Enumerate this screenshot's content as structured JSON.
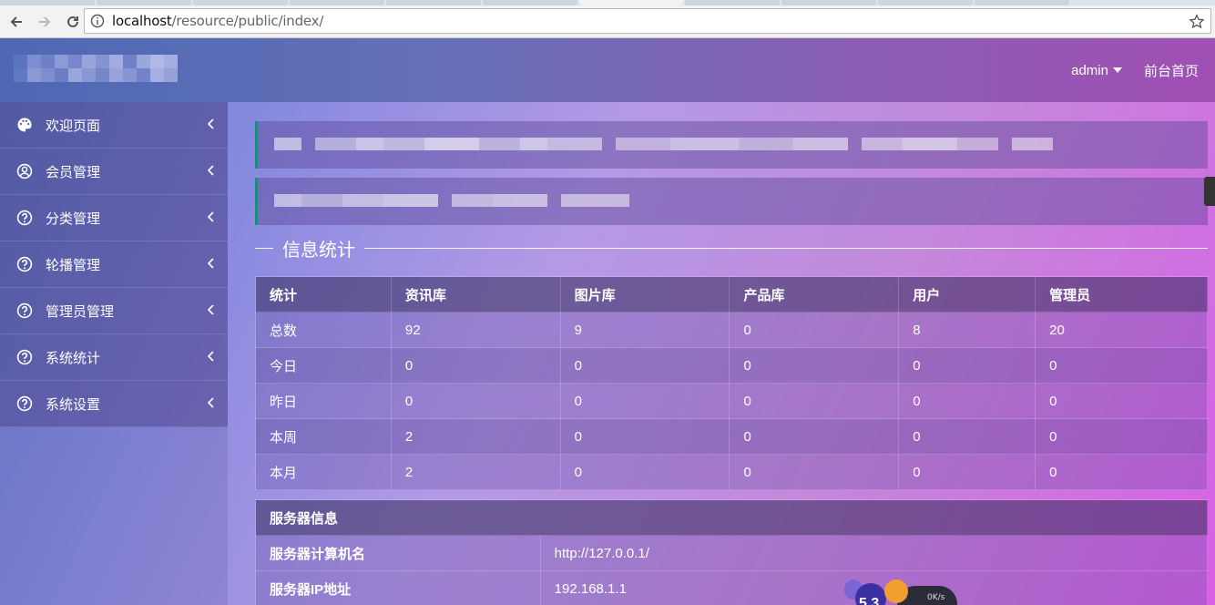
{
  "browser": {
    "url_host": "localhost",
    "url_path": "/resource/public/index/"
  },
  "header": {
    "user_label": "admin",
    "front_link": "前台首页"
  },
  "sidebar": {
    "items": [
      {
        "label": "欢迎页面",
        "icon": "palette-icon"
      },
      {
        "label": "会员管理",
        "icon": "user-circle-icon"
      },
      {
        "label": "分类管理",
        "icon": "question-circle-icon"
      },
      {
        "label": "轮播管理",
        "icon": "question-circle-icon"
      },
      {
        "label": "管理员管理",
        "icon": "question-circle-icon"
      },
      {
        "label": "系统统计",
        "icon": "question-circle-icon"
      },
      {
        "label": "系统设置",
        "icon": "question-circle-icon"
      }
    ]
  },
  "section": {
    "title": "信息统计"
  },
  "stats": {
    "headers": [
      "统计",
      "资讯库",
      "图片库",
      "产品库",
      "用户",
      "管理员"
    ],
    "rows": [
      [
        "总数",
        "92",
        "9",
        "0",
        "8",
        "20"
      ],
      [
        "今日",
        "0",
        "0",
        "0",
        "0",
        "0"
      ],
      [
        "昨日",
        "0",
        "0",
        "0",
        "0",
        "0"
      ],
      [
        "本周",
        "2",
        "0",
        "0",
        "0",
        "0"
      ],
      [
        "本月",
        "2",
        "0",
        "0",
        "0",
        "0"
      ]
    ]
  },
  "server": {
    "header": "服务器信息",
    "rows": [
      {
        "key": "服务器计算机名",
        "value": "http://127.0.0.1/"
      },
      {
        "key": "服务器IP地址",
        "value": "192.168.1.1"
      }
    ]
  },
  "widget": {
    "speed": "0K/s",
    "badge": "5.3"
  },
  "colors": {
    "header_start": "#4e68b4",
    "header_end": "#a04fb4",
    "notice_border": "#1e8a80",
    "page_gradient_end": "#d860e6"
  }
}
